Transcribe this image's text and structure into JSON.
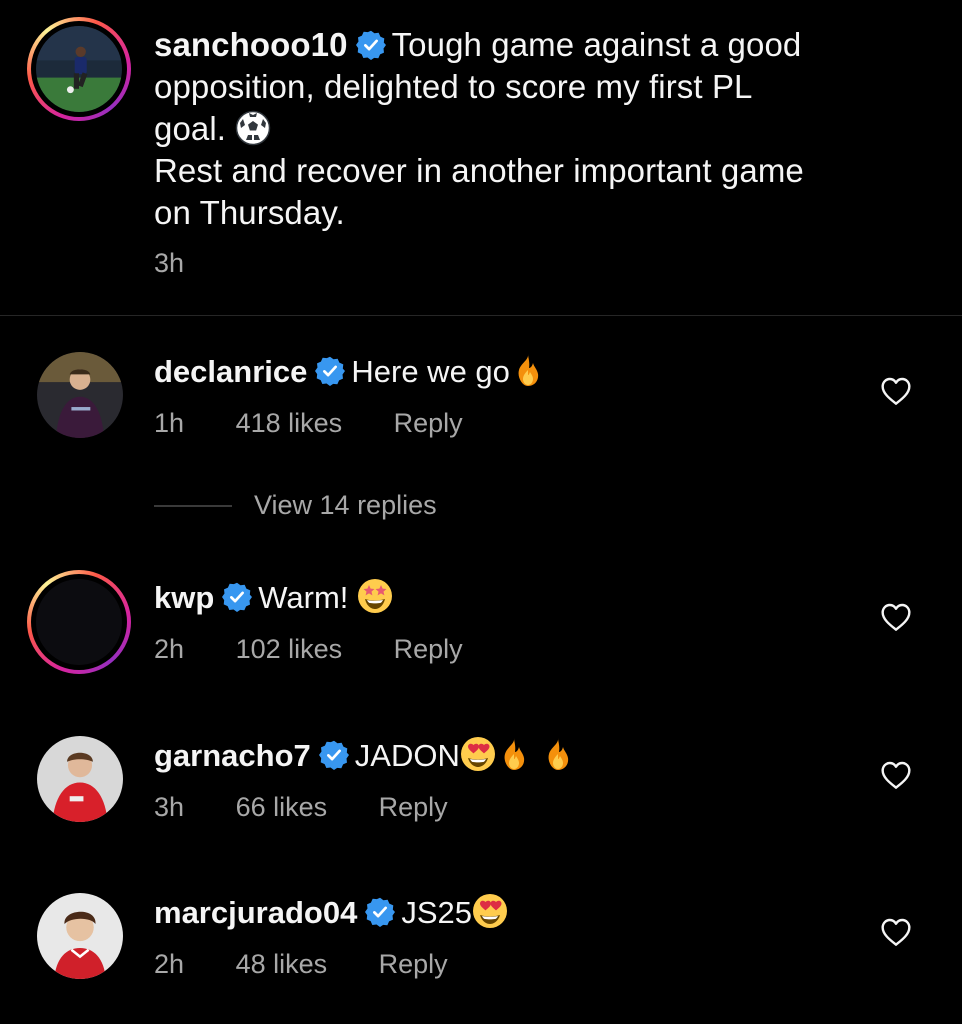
{
  "caption": {
    "username": "sanchooo10",
    "text": "Tough game against a good\nopposition, delighted to score my first PL\ngoal. ",
    "text2": "\nRest and recover in another important game\non Thursday.",
    "emoji": "soccer-ball",
    "time": "3h"
  },
  "comments": [
    {
      "username": "declanrice",
      "text": "Here we go",
      "emojis": [
        "fire"
      ],
      "time": "1h",
      "likes": "418 likes",
      "reply": "Reply"
    },
    {
      "username": "kwp",
      "text": "Warm! ",
      "emojis": [
        "star-struck"
      ],
      "time": "2h",
      "likes": "102 likes",
      "reply": "Reply"
    },
    {
      "username": "garnacho7",
      "text": "JADON",
      "emojis": [
        "heart-eyes",
        "fire",
        "fire"
      ],
      "time": "3h",
      "likes": "66 likes",
      "reply": "Reply"
    },
    {
      "username": "marcjurado04",
      "text": "JS25",
      "emojis": [
        "heart-eyes"
      ],
      "time": "2h",
      "likes": "48 likes",
      "reply": "Reply"
    }
  ],
  "view_replies": "View 14 replies",
  "colors": {
    "background": "#000000",
    "text": "#f5f5f5",
    "muted": "#a8a8a8",
    "verified": "#3897f0"
  }
}
